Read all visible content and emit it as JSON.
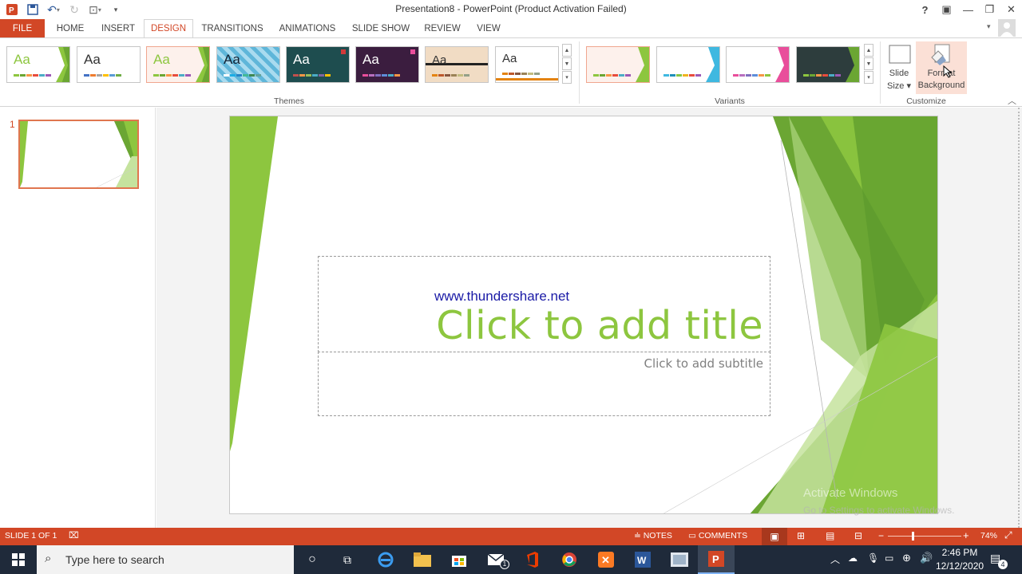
{
  "window": {
    "title": "Presentation8 - PowerPoint (Product Activation Failed)",
    "controls": [
      "?",
      "▣",
      "—",
      "❐",
      "✕"
    ]
  },
  "ribbon_tabs": [
    {
      "label": "FILE"
    },
    {
      "label": "HOME"
    },
    {
      "label": "INSERT"
    },
    {
      "label": "DESIGN"
    },
    {
      "label": "TRANSITIONS"
    },
    {
      "label": "ANIMATIONS"
    },
    {
      "label": "SLIDE SHOW"
    },
    {
      "label": "REVIEW"
    },
    {
      "label": "VIEW"
    }
  ],
  "ribbon": {
    "themes_label": "Themes",
    "variants_label": "Variants",
    "customize_label": "Customize",
    "theme_sample_text": "Aa",
    "slide_size": {
      "line1": "Slide",
      "line2": "Size ▾"
    },
    "format_background": {
      "line1": "Format",
      "line2": "Background"
    }
  },
  "thumbnail": {
    "number": "1"
  },
  "slide": {
    "url_text": "www.thundershare.net",
    "title_placeholder": "Click to add title",
    "subtitle_placeholder": "Click to add subtitle",
    "watermark_line1": "Activate Windows",
    "watermark_line2": "Go to Settings to activate Windows."
  },
  "status": {
    "slide_counter": "SLIDE 1 OF 1",
    "notes": "NOTES",
    "comments": "COMMENTS",
    "zoom": "74%"
  },
  "taskbar": {
    "search_placeholder": "Type here to search",
    "time": "2:46 PM",
    "date": "12/12/2020",
    "notification_count": "4",
    "mail_badge": "1"
  },
  "colors": {
    "accent": "#d24726",
    "green_dark": "#6ba633",
    "green": "#8dc63f",
    "green_light": "#c5e39e",
    "url_blue": "#1a1aa6",
    "taskbar": "#1f2a3a"
  }
}
